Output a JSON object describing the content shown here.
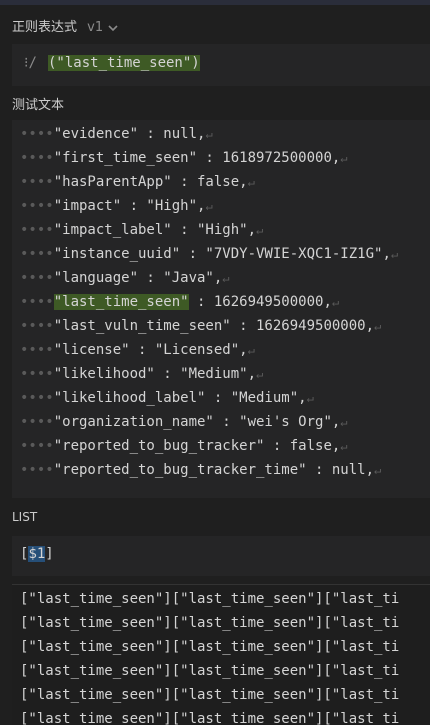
{
  "regex_section": {
    "title": "正则表达式",
    "version": "v1",
    "prefix": "⁝/",
    "pattern": "(\"last_time_seen\")"
  },
  "test_section": {
    "title": "测试文本",
    "lines": [
      {
        "text": "\"evidence\" : null,"
      },
      {
        "text": "\"first_time_seen\" : 1618972500000,"
      },
      {
        "text": "\"hasParentApp\" : false,"
      },
      {
        "text": "\"impact\" : \"High\","
      },
      {
        "text": "\"impact_label\" : \"High\","
      },
      {
        "text": "\"instance_uuid\" : \"7VDY-VWIE-XQC1-IZ1G\","
      },
      {
        "text": "\"language\" : \"Java\","
      },
      {
        "highlight": "\"last_time_seen\"",
        "rest": " : 1626949500000,"
      },
      {
        "text": "\"last_vuln_time_seen\" : 1626949500000,"
      },
      {
        "text": "\"license\" : \"Licensed\","
      },
      {
        "text": "\"likelihood\" : \"Medium\","
      },
      {
        "text": "\"likelihood_label\" : \"Medium\","
      },
      {
        "text": "\"organization_name\" : \"wei's Org\","
      },
      {
        "text": "\"reported_to_bug_tracker\" : false,"
      },
      {
        "text": "\"reported_to_bug_tracker_time\" : null,"
      }
    ],
    "return_mark": "↵"
  },
  "list_section": {
    "title": "LIST",
    "template_open": "[",
    "template_token": "$1",
    "template_close": "]",
    "results": [
      "[\"last_time_seen\"][\"last_time_seen\"][\"last_ti",
      "[\"last_time_seen\"][\"last_time_seen\"][\"last_ti",
      "[\"last_time_seen\"][\"last_time_seen\"][\"last_ti",
      "[\"last_time_seen\"][\"last_time_seen\"][\"last_ti",
      "[\"last_time_seen\"][\"last_time_seen\"][\"last_ti",
      "[\"last_time_seen\"][\"last_time_seen\"][\"last_ti"
    ]
  },
  "colors": {
    "highlight": "#3e5a25",
    "token_bg": "#264f78",
    "paren": "#e8c060"
  }
}
